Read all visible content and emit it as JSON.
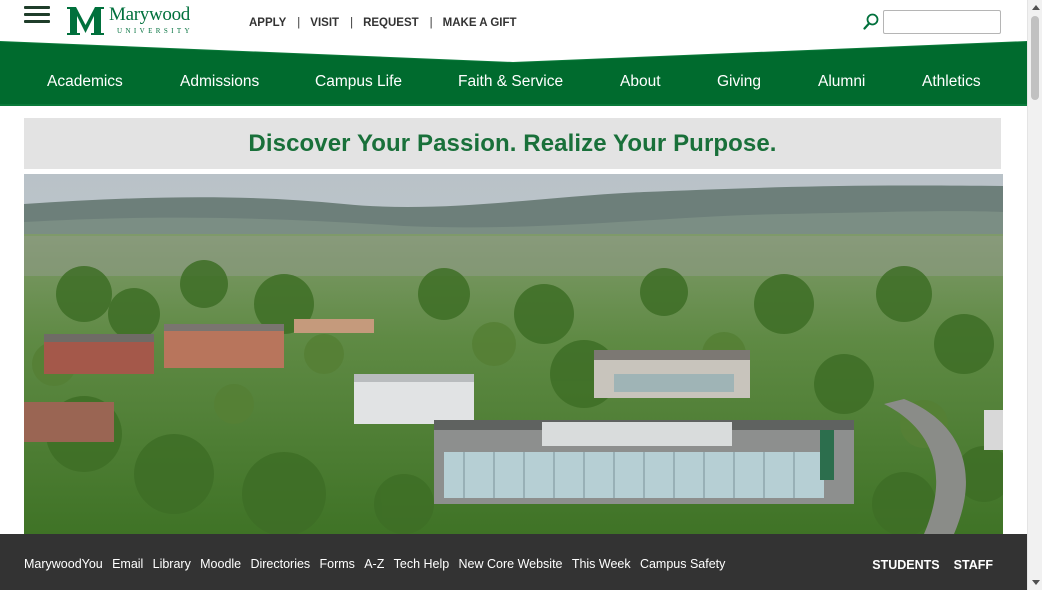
{
  "logo": {
    "name": "Marywood",
    "sub": "UNIVERSITY"
  },
  "utility": {
    "apply": "APPLY",
    "visit": "VISIT",
    "request": "REQUEST",
    "gift": "MAKE A GIFT",
    "sep": "|"
  },
  "search": {
    "placeholder": ""
  },
  "nav": [
    "Academics",
    "Admissions",
    "Campus Life",
    "Faith & Service",
    "About",
    "Giving",
    "Alumni",
    "Athletics"
  ],
  "tagline": "Discover Your Passion. Realize Your Purpose.",
  "quick_links": [
    "MarywoodYou",
    "Email",
    "Library",
    "Moodle",
    "Directories",
    "Forms",
    "A-Z",
    "Tech Help",
    "New Core Website",
    "This Week",
    "Campus Safety"
  ],
  "roles": {
    "students": "STUDENTS",
    "staff": "STAFF"
  },
  "colors": {
    "brand_green": "#00703c",
    "tagline_green": "#19703a",
    "footer": "#333333"
  }
}
